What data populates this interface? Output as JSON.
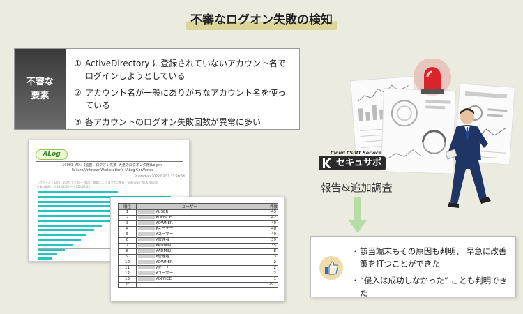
{
  "title": "不審なログオン失敗の検知",
  "factors": {
    "label_line1": "不審な",
    "label_line2": "要素",
    "items": [
      {
        "num": "①",
        "text": "ActiveDirectory に登録されていないアカウント名で ログインしようとしている"
      },
      {
        "num": "②",
        "text": "アカウント名が一般にありがちなアカウント名を使っている"
      },
      {
        "num": "③",
        "text": "各アカウントのログオン失敗回数が異常に多い"
      }
    ]
  },
  "report_doc": {
    "logo": "ALog",
    "title": "10003_AD：【監査】ログオン失敗_大量のログオン失敗(Logon-Failure/UnknownWorkstation)（ALog ConVerter",
    "printed": "Printed on 2022/03/21 11:20:54",
    "note": "［ファイル｜1/05 | 10/05 | ネスト・権限」検査により ログオン失敗　Unknown Workstation",
    "period": "※集計期間：2022/02/01 ～ 2022/02/28",
    "bar_values": [
      60,
      100,
      92,
      82,
      72,
      62,
      56,
      48,
      42,
      36,
      32,
      26,
      20,
      14,
      10,
      7,
      6,
      5,
      4
    ]
  },
  "rank_table": {
    "headers": [
      "順位",
      "ユーザー",
      "件数"
    ],
    "rows": [
      {
        "rank": "1",
        "user": "¥USER",
        "count": "43"
      },
      {
        "rank": "2",
        "user": "¥OFFICE",
        "count": "42"
      },
      {
        "rank": "3",
        "user": "¥OWNER",
        "count": "40"
      },
      {
        "rank": "4",
        "user": "¥オーナー",
        "count": "40"
      },
      {
        "rank": "5",
        "user": "¥ユーザー",
        "count": "40"
      },
      {
        "rank": "6",
        "user": "¥管理者",
        "count": "39"
      },
      {
        "rank": "7",
        "user": "¥ADMIN",
        "count": "35"
      },
      {
        "rank": "8",
        "user": "¥ADMIN",
        "count": "8"
      },
      {
        "rank": "9",
        "user": "¥管理者",
        "count": "3"
      },
      {
        "rank": "10",
        "user": "¥OWNER",
        "count": "2"
      },
      {
        "rank": "11",
        "user": "¥オーナー",
        "count": "2"
      },
      {
        "rank": "12",
        "user": "¥ユーザー",
        "count": "2"
      },
      {
        "rank": "13",
        "user": "¥OFFICE",
        "count": "1"
      },
      {
        "rank": "計",
        "user": "",
        "count": "297"
      }
    ]
  },
  "service": {
    "sub": "Cloud CSIRT Service",
    "name": "セキュサポ",
    "action": "報告&追加調査"
  },
  "results": [
    {
      "dot": "・",
      "text": "該当端末もその原因も判明、 早急に改善策を打つことができた"
    },
    {
      "dot": "・",
      "text": "“侵入は成功しなかった” ことも判明できた"
    }
  ],
  "colors": {
    "bar": "#28c3c3",
    "siren": "#d8242a",
    "arrow": "#b7dca8",
    "suit": "#1f3566"
  }
}
